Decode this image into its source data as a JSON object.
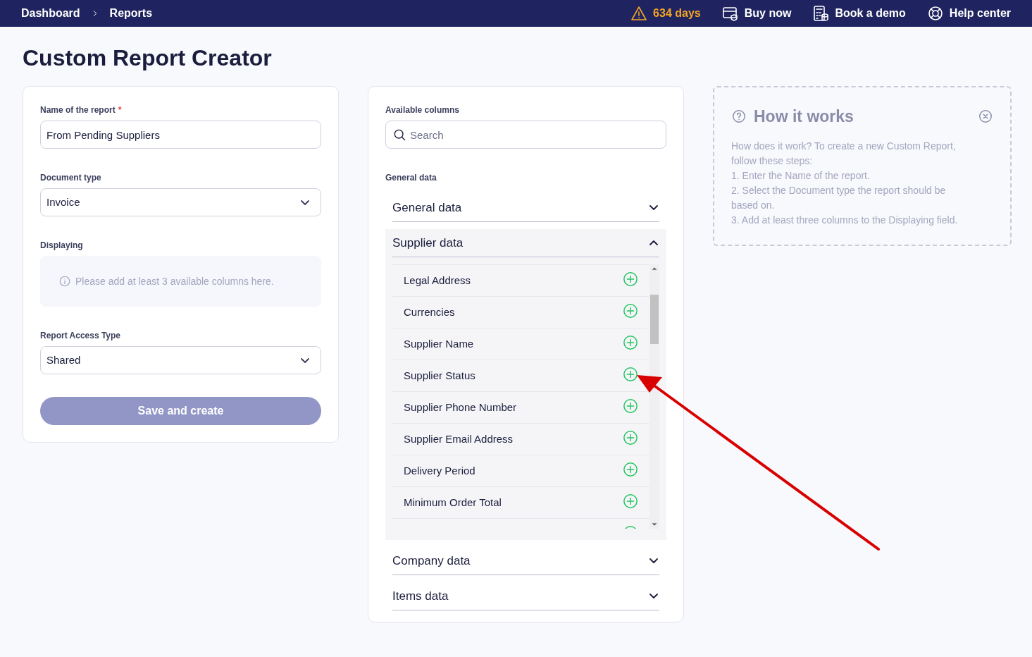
{
  "topbar": {
    "breadcrumbs": [
      "Dashboard",
      "Reports"
    ],
    "trial": "634 days",
    "actions": [
      {
        "kind": "buy",
        "label": "Buy now"
      },
      {
        "kind": "demo",
        "label": "Book a demo"
      },
      {
        "kind": "help",
        "label": "Help center"
      }
    ]
  },
  "title": "Custom Report Creator",
  "form": {
    "name_label": "Name of the report",
    "required_mark": "*",
    "name_value": "From Pending Suppliers",
    "doc_label": "Document type",
    "doc_value": "Invoice",
    "displaying_label": "Displaying",
    "displaying_hint": "Please add at least 3 available columns here.",
    "access_label": "Report Access Type",
    "access_value": "Shared",
    "submit": "Save and create",
    "submit_disabled": true
  },
  "columns": {
    "label": "Available columns",
    "search_placeholder": "Search",
    "group_label": "General data",
    "sections": [
      {
        "title": "General data",
        "expanded": false
      },
      {
        "title": "Supplier data",
        "expanded": true,
        "items": [
          "Legal Address",
          "Currencies",
          "Supplier Name",
          "Supplier Status",
          "Supplier Phone Number",
          "Supplier Email Address",
          "Delivery Period",
          "Minimum Order Total"
        ]
      },
      {
        "title": "Company data",
        "expanded": false
      },
      {
        "title": "Items data",
        "expanded": false
      }
    ]
  },
  "help": {
    "title": "How it works",
    "lines": [
      "How does it work? To create a new Custom Report, follow these steps:",
      "1. Enter the Name of the report.",
      "2. Select the Document type the report should be based on.",
      "3. Add at least three columns to the Displaying field."
    ]
  }
}
